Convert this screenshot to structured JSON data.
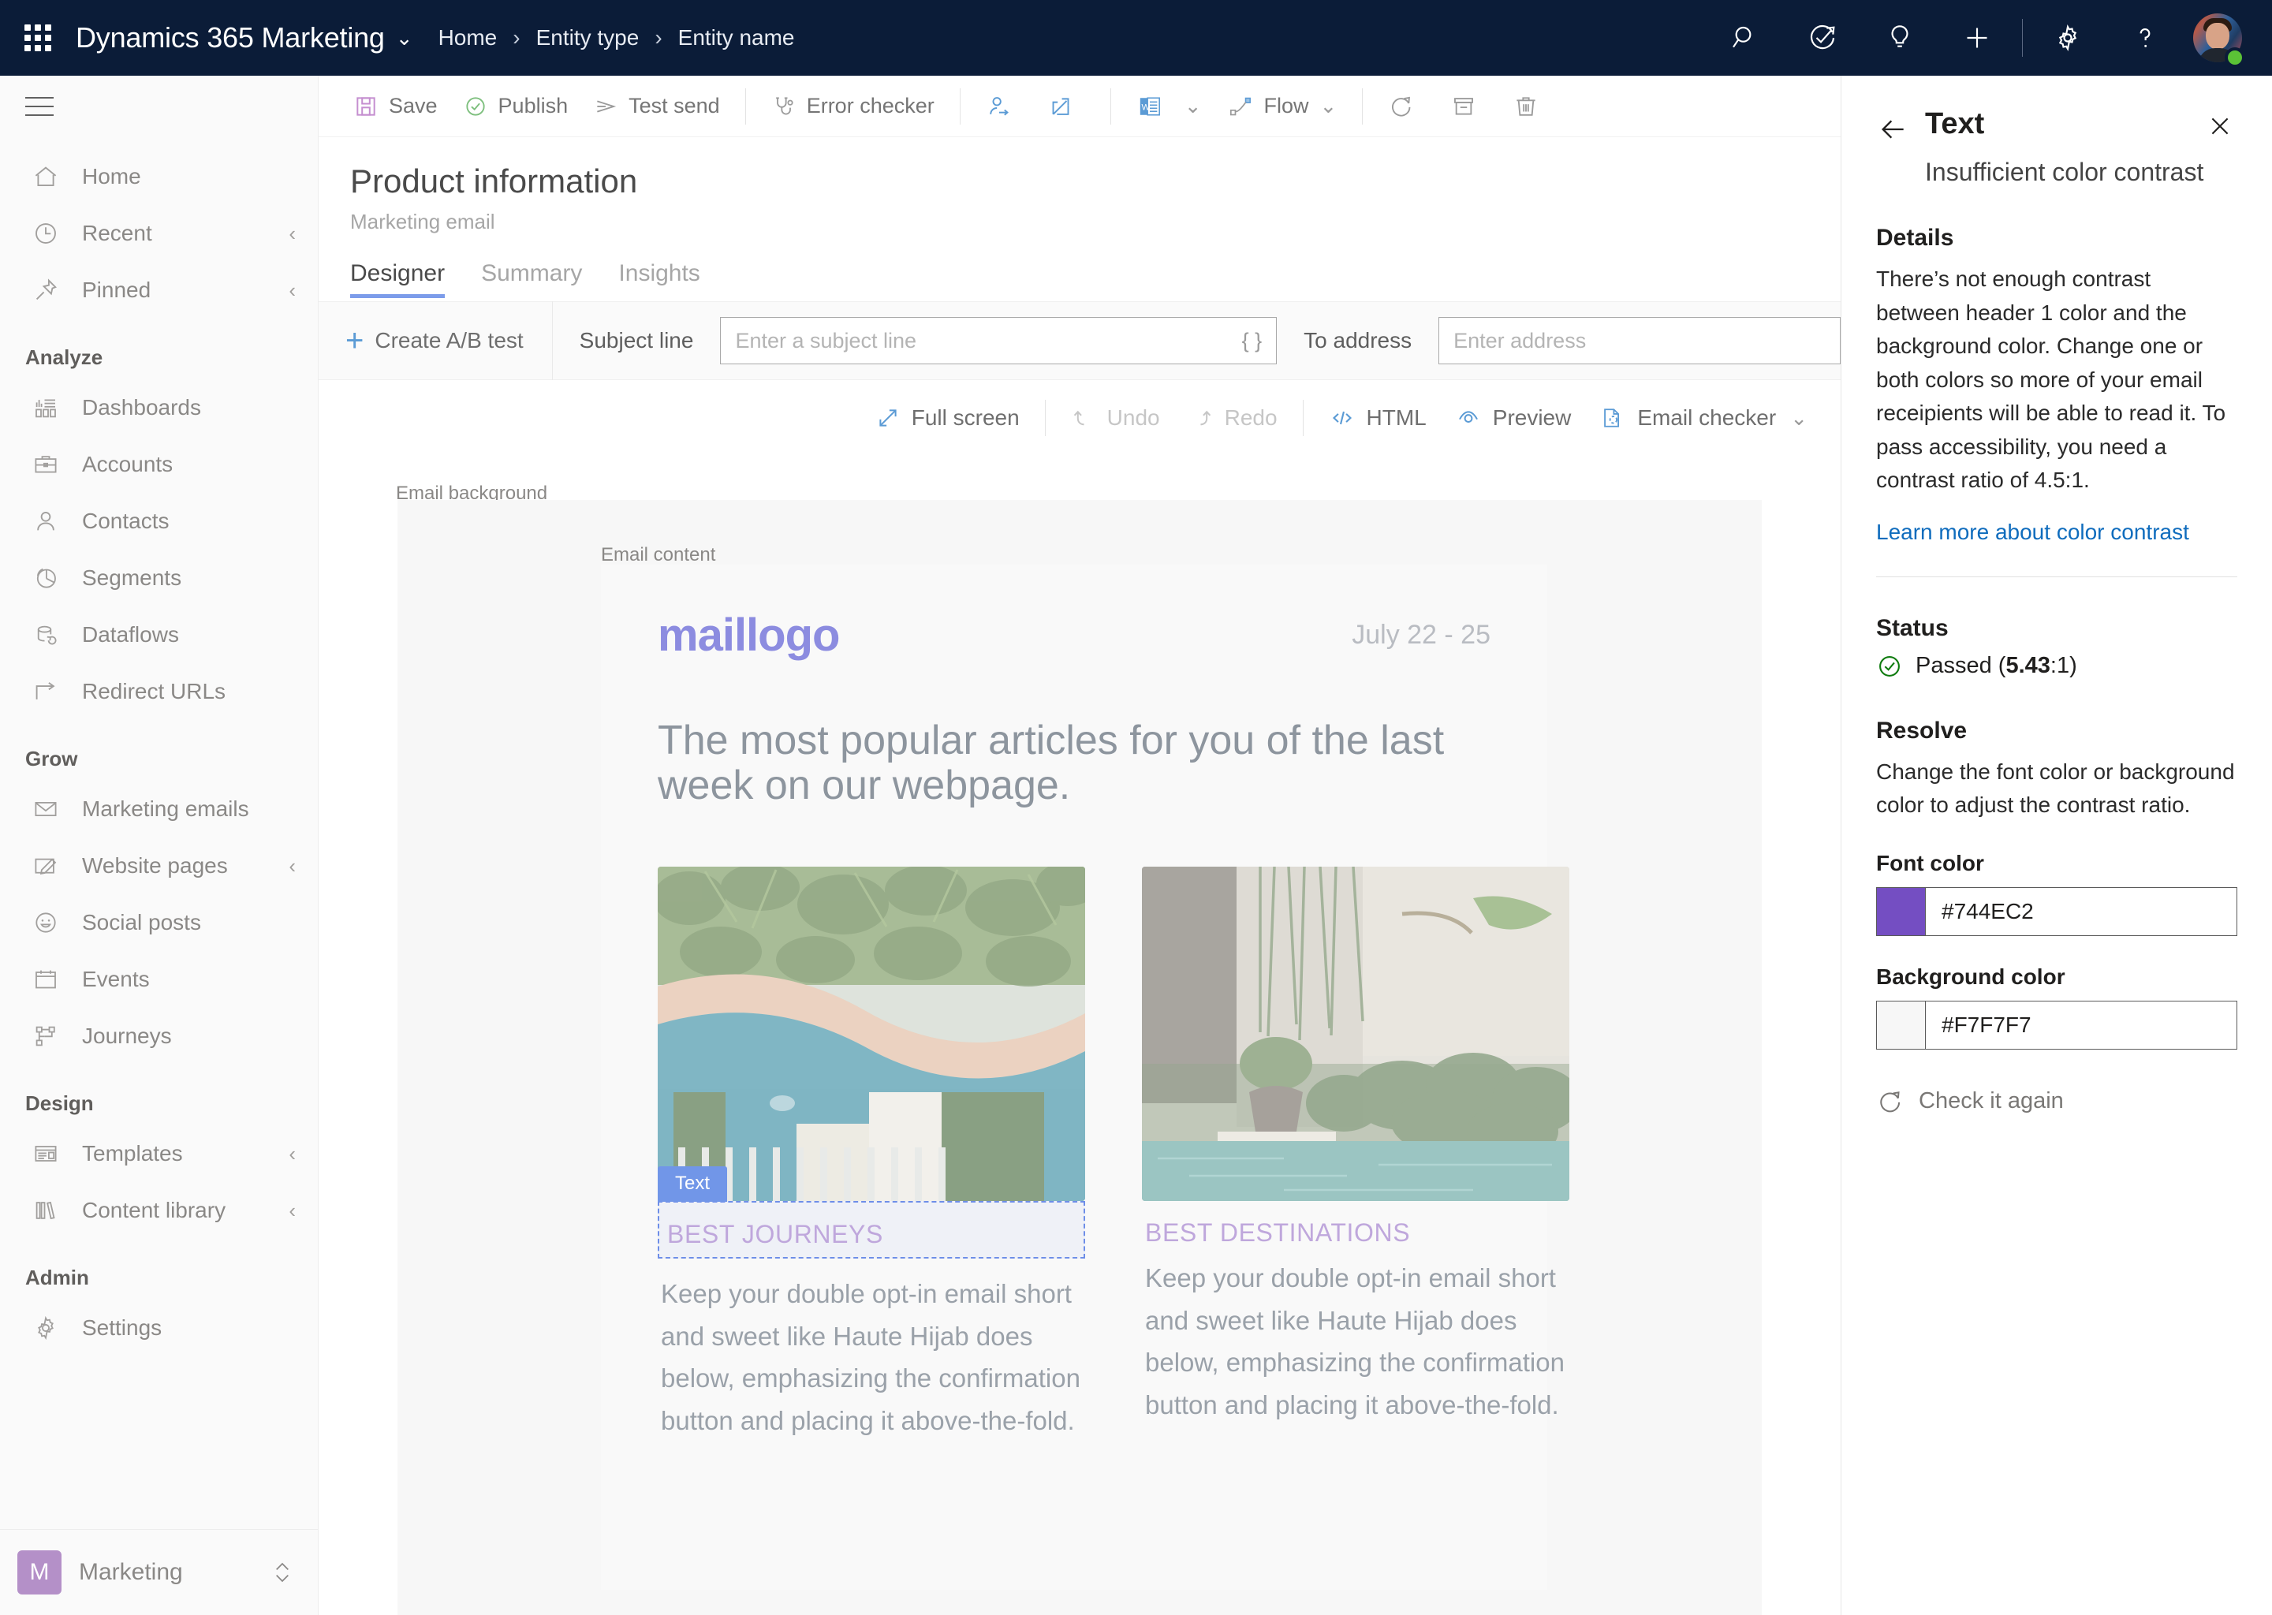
{
  "topbar": {
    "waffle_label": "app-launcher",
    "app_name": "Dynamics 365 Marketing",
    "app_chevron": "⌄",
    "breadcrumbs": [
      "Home",
      "Entity type",
      "Entity name"
    ],
    "separator": "›",
    "icons": [
      "search-icon",
      "goal-icon",
      "insights-bulb-icon",
      "add-icon",
      "settings-gear-icon",
      "help-question-icon"
    ]
  },
  "sidebar": {
    "groups": [
      {
        "label": "",
        "items": [
          {
            "label": "Home",
            "icon": "home-icon",
            "chevron": ""
          },
          {
            "label": "Recent",
            "icon": "clock-icon",
            "chevron": "‹"
          },
          {
            "label": "Pinned",
            "icon": "pin-icon",
            "chevron": "‹"
          }
        ]
      },
      {
        "label": "Analyze",
        "items": [
          {
            "label": "Dashboards",
            "icon": "dashboard-icon",
            "chevron": ""
          },
          {
            "label": "Accounts",
            "icon": "briefcase-icon",
            "chevron": ""
          },
          {
            "label": "Contacts",
            "icon": "person-icon",
            "chevron": ""
          },
          {
            "label": "Segments",
            "icon": "pie-chart-icon",
            "chevron": ""
          },
          {
            "label": "Dataflows",
            "icon": "dataflow-icon",
            "chevron": ""
          },
          {
            "label": "Redirect URLs",
            "icon": "redirect-arrow-icon",
            "chevron": ""
          }
        ]
      },
      {
        "label": "Grow",
        "items": [
          {
            "label": "Marketing emails",
            "icon": "envelope-icon",
            "chevron": ""
          },
          {
            "label": "Website pages",
            "icon": "page-edit-icon",
            "chevron": "‹"
          },
          {
            "label": "Social posts",
            "icon": "smiley-icon",
            "chevron": ""
          },
          {
            "label": "Events",
            "icon": "calendar-icon",
            "chevron": ""
          },
          {
            "label": "Journeys",
            "icon": "journey-flow-icon",
            "chevron": ""
          }
        ]
      },
      {
        "label": "Design",
        "items": [
          {
            "label": "Templates",
            "icon": "template-icon",
            "chevron": "‹"
          },
          {
            "label": "Content library",
            "icon": "library-icon",
            "chevron": "‹"
          }
        ]
      },
      {
        "label": "Admin",
        "items": [
          {
            "label": "Settings",
            "icon": "gear-icon",
            "chevron": ""
          }
        ]
      }
    ],
    "area_switcher": {
      "badge": "M",
      "name": "Marketing",
      "chevron": "⌃⌄"
    }
  },
  "commandbar": {
    "items": [
      {
        "label": "Save",
        "icon": "save-floppy-icon"
      },
      {
        "label": "Publish",
        "icon": "publish-check-icon"
      },
      {
        "label": "Test send",
        "icon": "send-paperplane-icon"
      },
      {
        "label": "Error checker",
        "icon": "stethoscope-icon"
      },
      {
        "label": "",
        "icon": "assign-user-icon"
      },
      {
        "label": "",
        "icon": "share-icon"
      },
      {
        "label": "",
        "icon": "word-export-icon"
      },
      {
        "label": "Flow",
        "icon": "flow-icon"
      },
      {
        "label": "",
        "icon": "refresh-icon"
      },
      {
        "label": "",
        "icon": "archive-icon"
      },
      {
        "label": "",
        "icon": "delete-trash-icon"
      }
    ]
  },
  "page": {
    "title": "Product information",
    "subtitle": "Marketing email",
    "tabs": [
      {
        "label": "Designer",
        "active": true
      },
      {
        "label": "Summary",
        "active": false
      },
      {
        "label": "Insights",
        "active": false
      }
    ]
  },
  "subject_row": {
    "ab_test_label": "Create A/B test",
    "subject_label": "Subject line",
    "subject_value": "",
    "subject_placeholder": "Enter a subject line",
    "personalization_glyph": "{ }",
    "to_label": "To address",
    "to_value": "",
    "to_placeholder": "Enter address"
  },
  "designer_toolbar": {
    "items": [
      {
        "label": "Full screen",
        "icon": "fullscreen-arrow-icon",
        "disabled": false
      },
      {
        "label": "Undo",
        "icon": "undo-icon",
        "disabled": true
      },
      {
        "label": "Redo",
        "icon": "redo-icon",
        "disabled": true
      },
      {
        "label": "HTML",
        "icon": "code-brackets-icon",
        "disabled": false
      },
      {
        "label": "Preview",
        "icon": "eye-preview-icon",
        "disabled": false
      },
      {
        "label": "Email checker",
        "icon": "email-checker-icon",
        "disabled": false
      }
    ],
    "overflow_chevron": "⌄"
  },
  "canvas": {
    "background_label": "Email background",
    "content_label": "Email content",
    "email": {
      "logo": "maillogo",
      "date": "July 22 - 25",
      "headline": "The most popular articles for you of the last week on our webpage.",
      "cards": [
        {
          "heading": "BEST JOURNEYS",
          "body": "Keep your double opt-in email short and sweet like Haute Hijab does below, emphasizing the confirmation button and placing it above-the-fold.",
          "image_alt": "pool-with-curved-coping-and-tropical-plants",
          "selected": true,
          "selection_tag": "Text"
        },
        {
          "heading": "BEST DESTINATIONS",
          "body": "Keep your double opt-in email short and sweet like Haute Hijab does below, emphasizing the confirmation button and placing it above-the-fold.",
          "image_alt": "courtyard-pool-with-potted-palms",
          "selected": false,
          "selection_tag": ""
        }
      ]
    }
  },
  "right_panel": {
    "back_glyph": "←",
    "close_glyph": "✕",
    "title": "Text",
    "subtitle": "Insufficient color contrast",
    "details_heading": "Details",
    "details_text": "There’s not enough contrast between header 1 color and the background color. Change one or both colors so more of your email receipients will be able to read it. To pass accessibility, you need a contrast ratio of 4.5:1.",
    "learn_more": "Learn more about color contrast",
    "status_heading": "Status",
    "status_prefix": "Passed (",
    "status_ratio": "5.43",
    "status_suffix": ":1)",
    "resolve_heading": "Resolve",
    "resolve_text": "Change the font color or background color to adjust the contrast ratio.",
    "font_color_label": "Font color",
    "font_color_value": "#744EC2",
    "background_color_label": "Background color",
    "background_color_value": "#F7F7F7",
    "recheck_label": "Check it again"
  },
  "colors": {
    "topbar_bg": "#0B1C38",
    "accent_blue": "#7C9CEA",
    "link_blue": "#0F6CBD",
    "pass_green": "#107C10",
    "font_color_swatch": "#744EC2",
    "bg_color_swatch": "#F7F7F7",
    "selection_blue": "#7196E8",
    "logo_purple": "#8C8CE0",
    "card_heading_purple": "#BFA7DC",
    "area_badge": "#B490C8"
  }
}
